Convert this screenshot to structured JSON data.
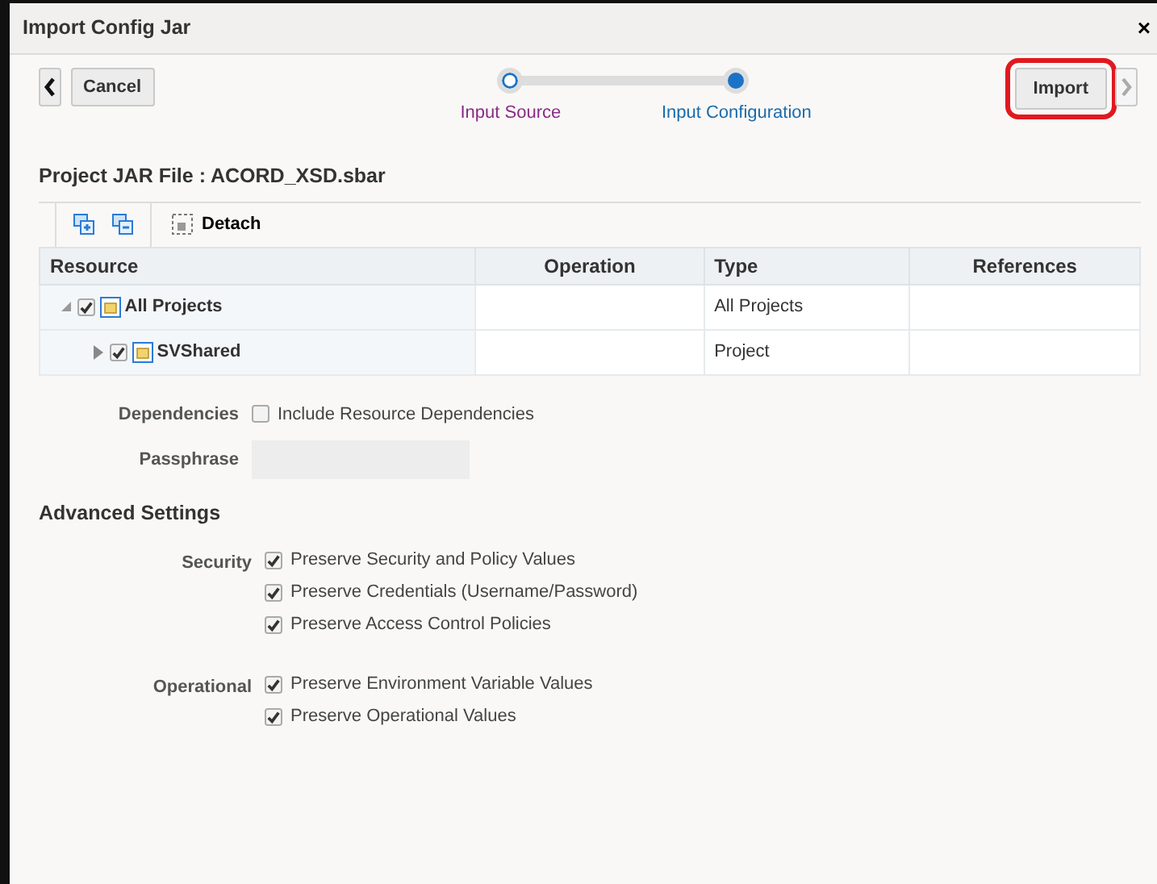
{
  "window": {
    "title": "Import Config Jar",
    "close": "×"
  },
  "nav": {
    "back_enabled": true,
    "cancel": "Cancel",
    "import": "Import",
    "import_highlighted": true,
    "next_enabled": false
  },
  "steps": [
    {
      "label": "Input Source",
      "selected": false
    },
    {
      "label": "Input Configuration",
      "selected": true
    }
  ],
  "project_heading": "Project JAR File : ACORD_XSD.sbar",
  "toolbar": {
    "detach": "Detach"
  },
  "table": {
    "columns": [
      "Resource",
      "Operation",
      "Type",
      "References"
    ],
    "rows": [
      {
        "name": "All Projects",
        "expanded": true,
        "checked": true,
        "type": "All Projects",
        "children": [
          {
            "name": "SVShared",
            "expanded": false,
            "checked": true,
            "type": "Project"
          }
        ]
      }
    ]
  },
  "dependencies": {
    "label": "Dependencies",
    "option": "Include Resource Dependencies",
    "checked": false
  },
  "passphrase": {
    "label": "Passphrase"
  },
  "advanced": {
    "title": "Advanced Settings",
    "groups": [
      {
        "label": "Security",
        "options": [
          {
            "label": "Preserve Security and Policy Values",
            "checked": true
          },
          {
            "label": "Preserve Credentials (Username/Password)",
            "checked": true
          },
          {
            "label": "Preserve Access Control Policies",
            "checked": true
          }
        ]
      },
      {
        "label": "Operational",
        "options": [
          {
            "label": "Preserve Environment Variable Values",
            "checked": true
          },
          {
            "label": "Preserve Operational Values",
            "checked": true
          }
        ]
      }
    ]
  }
}
